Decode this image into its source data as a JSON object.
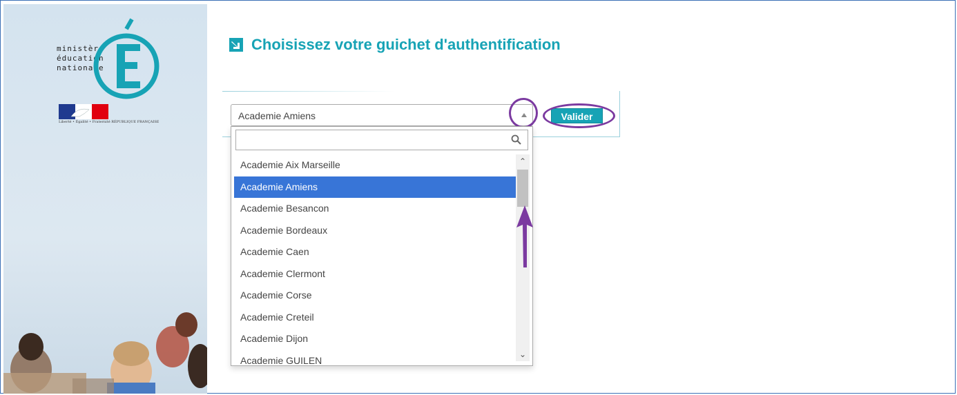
{
  "logo": {
    "lines": [
      "ministère",
      "éducation",
      "nationale"
    ],
    "flag_caption": "Liberté • Égalité • Fraternité  RÉPUBLIQUE FRANÇAISE"
  },
  "header": {
    "title": "Choisissez votre guichet d'authentification",
    "icon": "arrow-down-right-icon"
  },
  "form": {
    "selected_value": "Academie Amiens",
    "submit_label": "Valider",
    "search_value": ""
  },
  "dropdown": {
    "items": [
      "Academie Aix Marseille",
      "Academie Amiens",
      "Academie Besancon",
      "Academie Bordeaux",
      "Academie Caen",
      "Academie Clermont",
      "Academie Corse",
      "Academie Creteil",
      "Academie Dijon",
      "Academie GUILEN"
    ],
    "selected_index": 1
  },
  "colors": {
    "accent": "#17a3b5",
    "selected": "#3875d7",
    "annotation": "#7b3aa0"
  }
}
